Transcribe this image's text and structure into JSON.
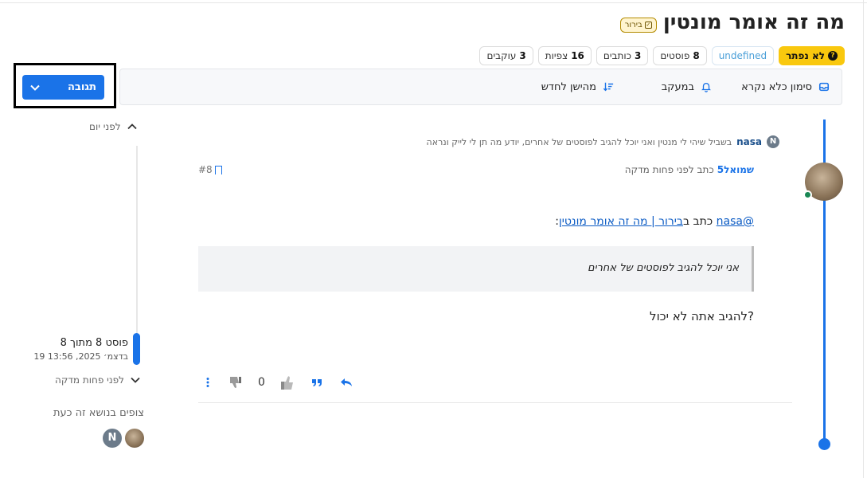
{
  "header": {
    "title": "מה זה אומר מונטין",
    "category": "בירור"
  },
  "stats": {
    "status": "לא נפתר",
    "undefined": "undefined",
    "posts_count": "8",
    "posts_label": "פוסטים",
    "writers_count": "3",
    "writers_label": "כותבים",
    "views_count": "16",
    "views_label": "צפיות",
    "followers_count": "3",
    "followers_label": "עוקבים"
  },
  "toolbar": {
    "mark_unread": "סימון כלא נקרא",
    "watching": "במעקב",
    "sort": "מהישן לחדש",
    "reply": "תגובה"
  },
  "timeline": {
    "top_label": "לפני יום",
    "current_post": "פוסט 8 מתוך 8",
    "current_date": "19 בדצמ׳ 2025, 13:56",
    "bottom_label": "לפני פחות מדקה"
  },
  "quoted_parent": {
    "user_initial": "N",
    "user": "nasa",
    "text": "בשביל שיהי לי מנטין ואני יוכל להגיב לפוסטים של אחרים, יודע מה תן לי לייק ונראה"
  },
  "post": {
    "author": "שמואל5",
    "time": "כתב לפני פחות מדקה",
    "index": "#8",
    "mention": "@nasa",
    "wrote_in": " כתב ב",
    "topic_link": "בירור | מה זה אומר מונטין",
    "colon": ":",
    "quote": "אני יוכל להגיב לפוסטים של אחרים",
    "body": "להגיב אתה לא יכול?",
    "votes": "0"
  },
  "watchers": {
    "title": "צופים בנושא זה כעת",
    "second_initial": "N"
  },
  "colors": {
    "accent": "#1a73e8",
    "warning": "#f9c80e",
    "online": "#198754"
  }
}
